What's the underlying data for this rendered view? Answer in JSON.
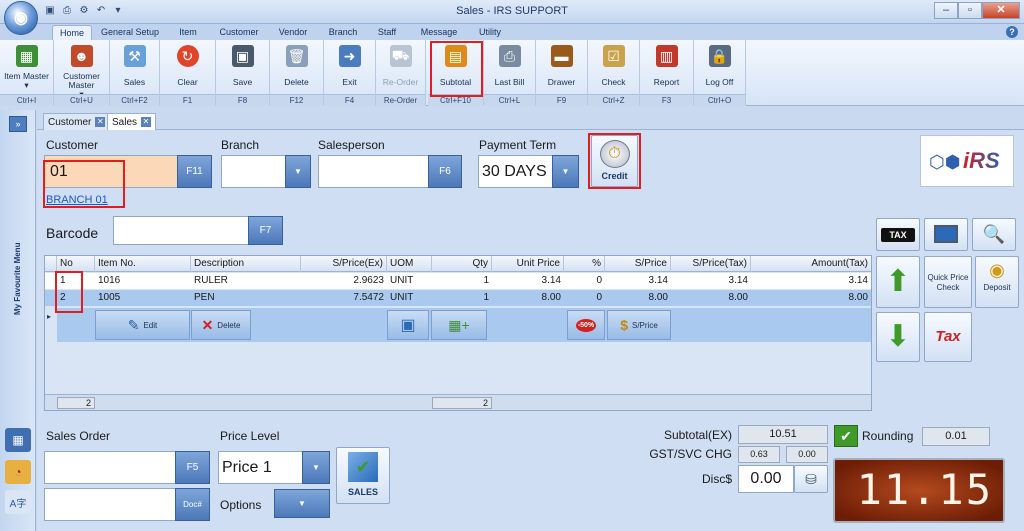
{
  "window": {
    "title": "Sales - IRS SUPPORT",
    "controls": {
      "minimize": "–",
      "restore": "▫",
      "close": "✕"
    },
    "qat_icons": [
      "save-icon",
      "print-icon",
      "settings-icon",
      "undo-icon",
      "dropdown-icon"
    ]
  },
  "ribbon_tabs": [
    {
      "label": "Home",
      "active": true
    },
    {
      "label": "General Setup"
    },
    {
      "label": "Item"
    },
    {
      "label": "Customer"
    },
    {
      "label": "Vendor"
    },
    {
      "label": "Branch"
    },
    {
      "label": "Staff"
    },
    {
      "label": "Message"
    },
    {
      "label": "Utility"
    }
  ],
  "ribbon_buttons": [
    {
      "label": "Item Master",
      "sub": "▾",
      "shortcut": "Ctrl+I",
      "icon": "item-master-icon",
      "color": "#3f8f3a"
    },
    {
      "label": "Customer Master",
      "sub": "▾",
      "shortcut": "Ctrl+U",
      "icon": "customer-master-icon",
      "color": "#c04a2a"
    },
    {
      "label": "Sales",
      "shortcut": "Ctrl+F2",
      "icon": "sales-icon",
      "color": "#6aa0d8"
    },
    {
      "label": "Clear",
      "shortcut": "F1",
      "icon": "clear-icon",
      "color": "#e0452a"
    },
    {
      "label": "Save",
      "shortcut": "F8",
      "icon": "save-icon",
      "color": "#4a5a6a"
    },
    {
      "label": "Delete",
      "shortcut": "F12",
      "icon": "delete-icon",
      "color": "#8aa0b8"
    },
    {
      "label": "Exit",
      "shortcut": "F4",
      "icon": "exit-icon",
      "color": "#4a7cc0"
    },
    {
      "label": "Re-Order",
      "shortcut": "Re-Order",
      "icon": "reorder-icon",
      "color": "#b8c4d4",
      "disabled": true
    },
    {
      "label": "Subtotal",
      "shortcut": "Ctrl+F10",
      "icon": "subtotal-icon",
      "color": "#e08a1a"
    },
    {
      "label": "Last Bill",
      "shortcut": "Ctrl+L",
      "icon": "last-bill-icon",
      "color": "#7a8aa0"
    },
    {
      "label": "Drawer",
      "shortcut": "F9",
      "icon": "drawer-icon",
      "color": "#9a5a1a"
    },
    {
      "label": "Check",
      "shortcut": "Ctrl+Z",
      "icon": "check-icon",
      "color": "#caa24a"
    },
    {
      "label": "Report",
      "shortcut": "F3",
      "icon": "report-icon",
      "color": "#c0392b"
    },
    {
      "label": "Log Off",
      "shortcut": "Ctrl+O",
      "icon": "log-off-icon",
      "color": "#5a6a80"
    }
  ],
  "sidebar": {
    "label": "My Favourite Menu"
  },
  "doc_tabs": [
    {
      "label": "Customer"
    },
    {
      "label": "Sales",
      "active": true
    }
  ],
  "form": {
    "customer_label": "Customer",
    "customer_value": "01",
    "customer_btn": "F11",
    "branch_link": "BRANCH 01",
    "branch_label": "Branch",
    "branch_value": "",
    "salesperson_label": "Salesperson",
    "salesperson_value": "",
    "salesperson_btn": "F6",
    "payment_term_label": "Payment Term",
    "payment_term_value": "30 DAYS",
    "credit_label": "Credit",
    "barcode_label": "Barcode",
    "barcode_value": "",
    "barcode_btn": "F7",
    "logo_text": "iRS"
  },
  "grid": {
    "columns": [
      "No",
      "Item No.",
      "Description",
      "S/Price(Ex)",
      "UOM",
      "Qty",
      "Unit Price",
      "%",
      "S/Price",
      "S/Price(Tax)",
      "Amount(Tax)"
    ],
    "rows": [
      [
        "1",
        "1016",
        "RULER",
        "2.9623",
        "UNIT",
        "1",
        "3.14",
        "0",
        "3.14",
        "3.14",
        "3.14"
      ],
      [
        "2",
        "1005",
        "PEN",
        "7.5472",
        "UNIT",
        "1",
        "8.00",
        "0",
        "8.00",
        "8.00",
        "8.00"
      ]
    ],
    "actions": {
      "edit": "Edit",
      "delete": "Delete",
      "discount": "-50%",
      "sprice": "S/Price"
    },
    "footer": {
      "count": "2",
      "qty_total": "2"
    }
  },
  "right_tools": {
    "tax_badge": "TAX",
    "quick_price": "Quick Price Check",
    "deposit": "Deposit",
    "tax": "Tax"
  },
  "bottom": {
    "sales_order_label": "Sales Order",
    "sales_order_value": "",
    "sales_order_btn": "F5",
    "doc_btn": "Doc#",
    "price_level_label": "Price Level",
    "price_level_value": "Price 1",
    "options_label": "Options",
    "sales_btn": "SALES"
  },
  "totals": {
    "subtotal_label": "Subtotal(EX)",
    "subtotal_value": "10.51",
    "gst_label": "GST/SVC CHG",
    "gst_value": "0.63",
    "svc_value": "0.00",
    "disc_label": "Disc$",
    "disc_value": "0.00",
    "rounding_label": "Rounding",
    "rounding_value": "0.01",
    "display_total": "11.15"
  }
}
